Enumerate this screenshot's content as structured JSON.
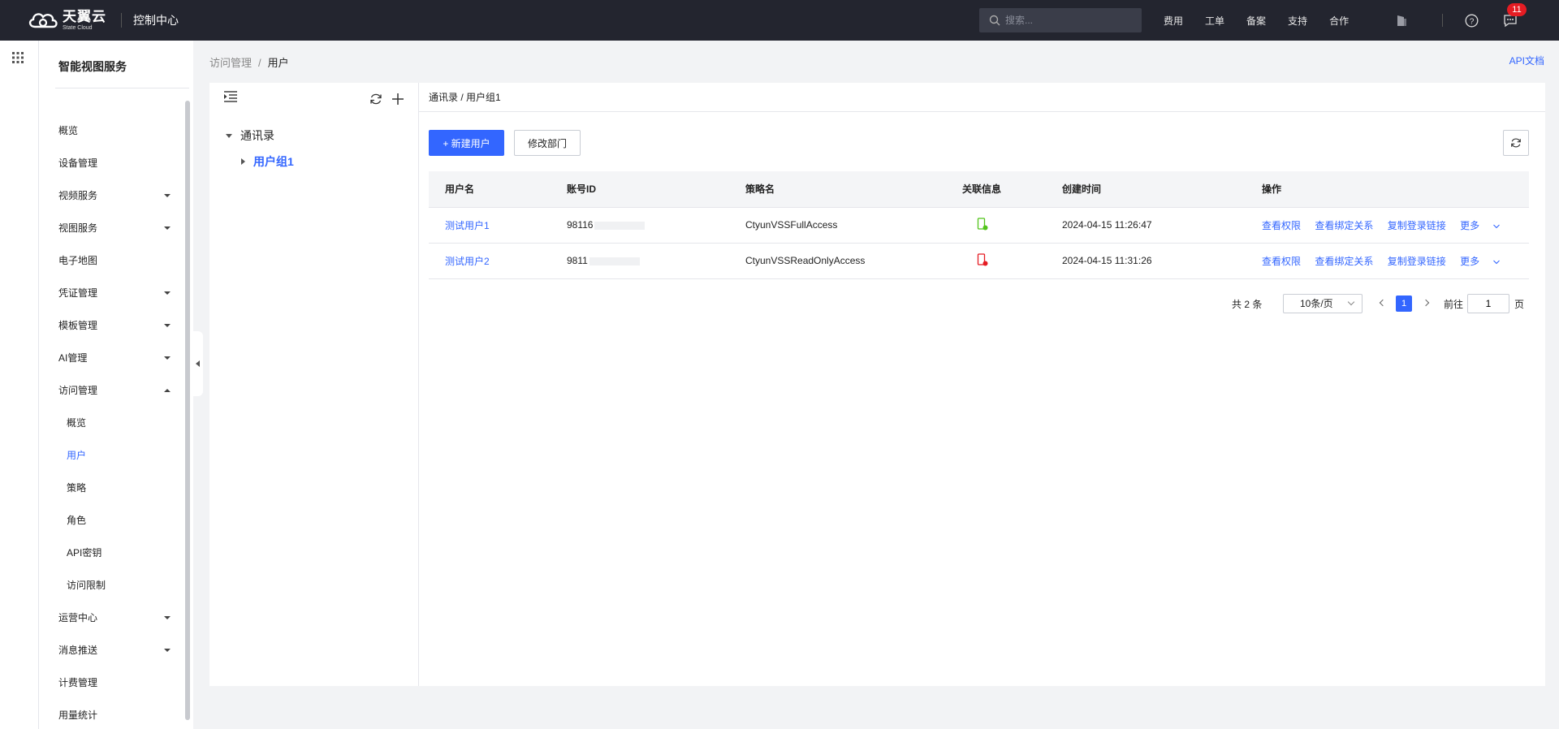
{
  "topbar": {
    "brand_cn": "天翼云",
    "brand_en": "State Cloud",
    "console": "控制中心",
    "search_placeholder": "搜索...",
    "nav": [
      "费用",
      "工单",
      "备案",
      "支持",
      "合作"
    ],
    "notification_count": "11"
  },
  "sidebar": {
    "title": "智能视图服务",
    "items": [
      {
        "label": "概览"
      },
      {
        "label": "设备管理"
      },
      {
        "label": "视频服务"
      },
      {
        "label": "视图服务"
      },
      {
        "label": "电子地图"
      },
      {
        "label": "凭证管理"
      },
      {
        "label": "模板管理"
      },
      {
        "label": "AI管理"
      },
      {
        "label": "访问管理"
      },
      {
        "label": "概览"
      },
      {
        "label": "用户"
      },
      {
        "label": "策略"
      },
      {
        "label": "角色"
      },
      {
        "label": "API密钥"
      },
      {
        "label": "访问限制"
      },
      {
        "label": "运营中心"
      },
      {
        "label": "消息推送"
      },
      {
        "label": "计费管理"
      },
      {
        "label": "用量统计"
      }
    ]
  },
  "breadcrumb": {
    "parent": "访问管理",
    "sep": "/",
    "current": "用户"
  },
  "api_doc": "API文档",
  "tree": {
    "root": "通讯录",
    "child": "用户组1"
  },
  "content": {
    "path": "通讯录 / 用户组1",
    "new_user": "+ 新建用户",
    "edit_dept": "修改部门"
  },
  "table": {
    "headers": [
      "用户名",
      "账号ID",
      "策略名",
      "关联信息",
      "创建时间",
      "操作"
    ],
    "rows": [
      {
        "name": "测试用户1",
        "account": "98116",
        "policy": "CtyunVSSFullAccess",
        "status": "green",
        "created": "2024-04-15 11:26:47"
      },
      {
        "name": "测试用户2",
        "account": "9811",
        "policy": "CtyunVSSReadOnlyAccess",
        "status": "red",
        "created": "2024-04-15 11:31:26"
      }
    ],
    "ops": [
      "查看权限",
      "查看绑定关系",
      "复制登录链接",
      "更多"
    ]
  },
  "pagination": {
    "total": "共 2 条",
    "page_size": "10条/页",
    "current": "1",
    "goto_label": "前往",
    "goto_value": "1",
    "page_unit": "页"
  },
  "colors": {
    "accent": "#3366ff",
    "topbar": "#23252f",
    "ok": "#52c41a",
    "bad": "#e51c23"
  }
}
